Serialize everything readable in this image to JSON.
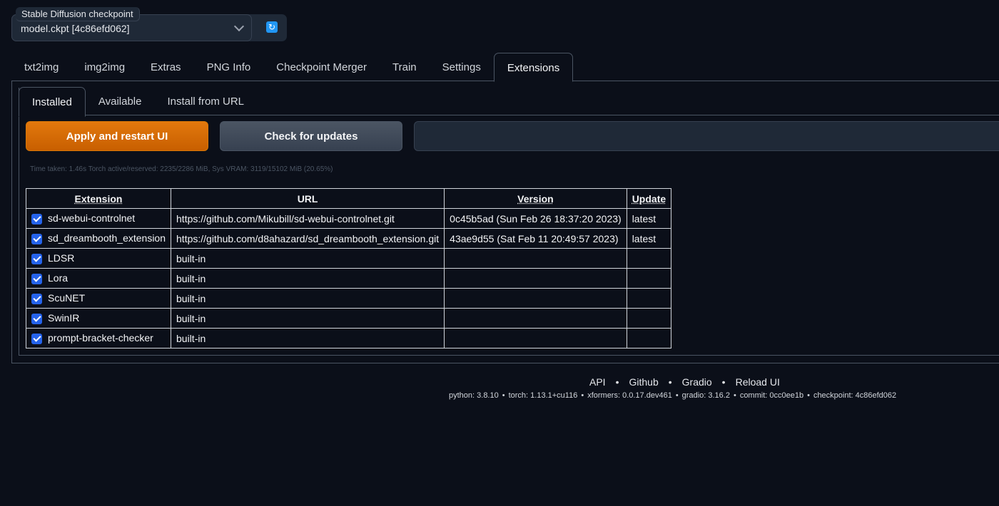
{
  "checkpoint": {
    "label": "Stable Diffusion checkpoint",
    "value": "model.ckpt [4c86efd062]"
  },
  "tabs": [
    "txt2img",
    "img2img",
    "Extras",
    "PNG Info",
    "Checkpoint Merger",
    "Train",
    "Settings",
    "Extensions"
  ],
  "subtabs": [
    "Installed",
    "Available",
    "Install from URL"
  ],
  "buttons": {
    "apply": "Apply and restart UI",
    "check": "Check for updates"
  },
  "timing": "Time taken: 1.46s  Torch active/reserved: 2235/2286 MiB, Sys VRAM: 3119/15102 MiB (20.65%)",
  "table": {
    "headers": [
      "Extension",
      "URL",
      "Version",
      "Update"
    ],
    "rows": [
      {
        "name": "sd-webui-controlnet",
        "url": "https://github.com/Mikubill/sd-webui-controlnet.git",
        "version": "0c45b5ad (Sun Feb 26 18:37:20 2023)",
        "update": "latest"
      },
      {
        "name": "sd_dreambooth_extension",
        "url": "https://github.com/d8ahazard/sd_dreambooth_extension.git",
        "version": "43ae9d55 (Sat Feb 11 20:49:57 2023)",
        "update": "latest"
      },
      {
        "name": "LDSR",
        "url": "built-in",
        "version": "",
        "update": ""
      },
      {
        "name": "Lora",
        "url": "built-in",
        "version": "",
        "update": ""
      },
      {
        "name": "ScuNET",
        "url": "built-in",
        "version": "",
        "update": ""
      },
      {
        "name": "SwinIR",
        "url": "built-in",
        "version": "",
        "update": ""
      },
      {
        "name": "prompt-bracket-checker",
        "url": "built-in",
        "version": "",
        "update": ""
      }
    ]
  },
  "footer": {
    "links": [
      "API",
      "Github",
      "Gradio",
      "Reload UI"
    ],
    "versions": [
      "python: 3.8.10",
      "torch: 1.13.1+cu116",
      "xformers: 0.0.17.dev461",
      "gradio: 3.16.2",
      "commit: 0cc0ee1b",
      "checkpoint: 4c86efd062"
    ]
  }
}
